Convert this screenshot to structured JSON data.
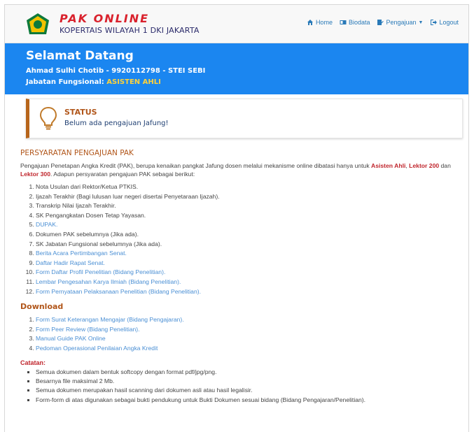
{
  "brand": {
    "title": "PAK ONLINE",
    "subtitle": "KOPERTAIS WILAYAH 1 DKI JAKARTA"
  },
  "nav": {
    "home": "Home",
    "biodata": "Biodata",
    "pengajuan": "Pengajuan",
    "logout": "Logout"
  },
  "hero": {
    "title": "Selamat Datang",
    "name_line": "Ahmad Sulhi Chotib - 9920112798 - STEI SEBI",
    "jabatan_label": "Jabatan Fungsional:",
    "jabatan_value": "ASISTEN AHLI"
  },
  "status": {
    "heading": "STATUS",
    "text": "Belum ada pengajuan Jafung!"
  },
  "requirements": {
    "heading": "PERSYARATAN PENGAJUAN PAK",
    "intro_1": "Pengajuan Penetapan Angka Kredit (PAK), berupa kenaikan pangkat Jafung dosen melalui mekanisme online dibatasi hanya untuk",
    "asisten": "Asisten Ahli",
    "sep1": ",",
    "lektor200": "Lektor 200",
    "intro_2": "dan",
    "lektor300": "Lektor 300",
    "intro_3": ". Adapun persyaratan pengajuan PAK sebagai berikut:",
    "items": [
      "Nota Usulan dari Rektor/Ketua PTKIS.",
      "Ijazah Terakhir (Bagi lulusan luar negeri disertai Penyetaraan Ijazah).",
      "Transkrip Nilai Ijazah Terakhir.",
      "SK Pengangkatan Dosen Tetap Yayasan.",
      "DUPAK.",
      "Dokumen PAK sebelumnya (Jika ada).",
      "SK Jabatan Fungsional sebelumnya (Jika ada).",
      "Berita Acara Pertimbangan Senat.",
      "Daftar Hadir Rapat Senat.",
      "Form Daftar Profil Penelitian (Bidang Penelitian).",
      "Lembar Pengesahan Karya Ilmiah (Bidang Penelitian).",
      "Form Pernyataan Pelaksanaan Penelitian (Bidang Penelitian)."
    ]
  },
  "download": {
    "heading": "Download",
    "items": [
      "Form Surat Keterangan Mengajar (Bidang Pengajaran).",
      "Form Peer Review (Bidang Penelitian).",
      "Manual Guide PAK Online",
      "Pedoman Operasional Penilaian Angka Kredit"
    ]
  },
  "notes": {
    "heading": "Catatan:",
    "items": [
      "Semua dokumen dalam bentuk softcopy dengan format pdf/jpg/png.",
      "Besarnya file maksimal 2 Mb.",
      "Semua dokumen merupakan hasil scanning dari dokumen asli atau hasil legalisir.",
      "Form-form di atas digunakan sebagai bukti pendukung untuk Bukti Dokumen sesuai bidang (Bidang Pengajaran/Penelitian)."
    ]
  },
  "colors": {
    "primary": "#1b86f0",
    "accent": "#b1561a",
    "brand_red": "#d9212c",
    "link": "#4a8fd4"
  }
}
